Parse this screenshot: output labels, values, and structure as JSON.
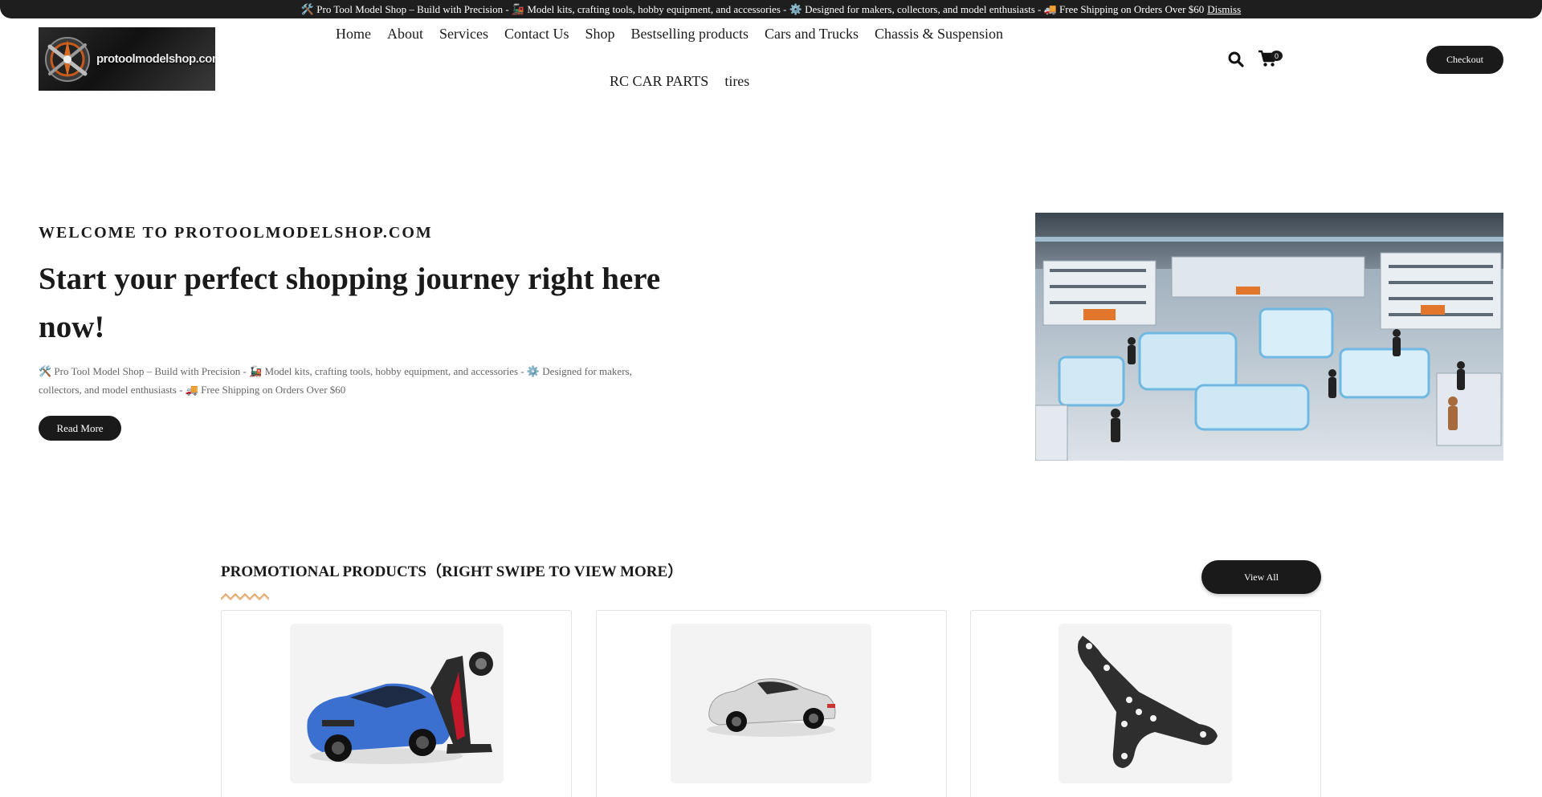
{
  "notice": {
    "text": "🛠️ Pro Tool Model Shop – Build with Precision - 🚂 Model kits, crafting tools, hobby equipment, and accessories - ⚙️ Designed for makers, collectors, and model enthusiasts - 🚚 Free Shipping on Orders Over $60",
    "dismiss_label": "Dismiss"
  },
  "header": {
    "logo_text": "protoolmodelshop.com",
    "nav_row1": [
      "Home",
      "About",
      "Services",
      "Contact Us",
      "Shop",
      "Bestselling products",
      "Cars and Trucks",
      "Chassis & Suspension"
    ],
    "nav_row2": [
      "RC CAR PARTS",
      "tires"
    ],
    "cart_count": "0",
    "checkout_label": "Checkout"
  },
  "hero": {
    "eyebrow": "WELCOME TO PROTOOLMODELSHOP.COM",
    "title": "Start your perfect shopping journey right here now!",
    "description": "🛠️ Pro Tool Model Shop – Build with Precision - 🚂 Model kits, crafting tools, hobby equipment, and accessories - ⚙️ Designed for makers, collectors, and model enthusiasts - 🚚 Free Shipping on Orders Over $60",
    "read_more_label": "Read More"
  },
  "promo": {
    "title": "PROMOTIONAL PRODUCTS（RIGHT SWIPE TO VIEW MORE）",
    "view_all_label": "View All"
  },
  "colors": {
    "dark": "#1a1a1a",
    "wave_accent": "#e0a060",
    "car_blue": "#3b6fd0"
  }
}
